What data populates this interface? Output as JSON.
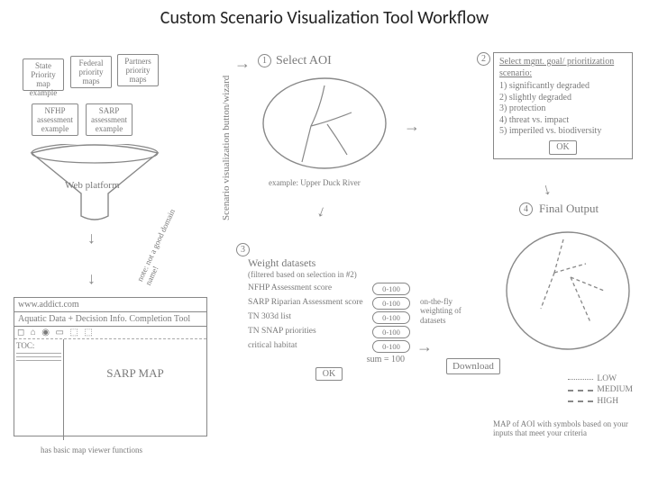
{
  "title": "Custom Scenario Visualization Tool Workflow",
  "inputs": {
    "a": "State Priority map example",
    "b": "Federal priority maps",
    "c": "Partners priority maps",
    "d": "NFHP assessment example",
    "e": "SARP assessment example"
  },
  "funnel_label": "Web platform",
  "side_note": "note: not a good domain name!",
  "vertical_label": "Scenario visualization button/wizard",
  "browser": {
    "url": "www.addict.com",
    "page_title": "Aquatic Data + Decision Info. Completion Tool",
    "toc_label": "TOC:",
    "toolbar_icons": "◻ ⌂ ◉ ▭ ⬚ ⬚",
    "map_label": "SARP MAP",
    "footer": "has basic map viewer functions"
  },
  "step1": {
    "num": "1",
    "title": "Select AOI",
    "example": "example: Upper Duck River"
  },
  "step2": {
    "num": "2",
    "title": "Select mgnt. goal/ prioritization scenario:",
    "opts": [
      "1) significantly degraded",
      "2) slightly degraded",
      "3) protection",
      "4) threat vs. impact",
      "5) imperiled vs. biodiversity"
    ],
    "ok": "OK"
  },
  "step3": {
    "num": "3",
    "title": "Weight datasets",
    "subtitle": "(filtered based on selection in #2)",
    "rows": [
      {
        "n": "NFHP Assessment score",
        "r": "0-100"
      },
      {
        "n": "SARP Riparian Assessment score",
        "r": "0-100"
      },
      {
        "n": "TN 303d list",
        "r": "0-100"
      },
      {
        "n": "TN SNAP priorities",
        "r": "0-100"
      },
      {
        "n": "critical habitat",
        "r": "0-100"
      }
    ],
    "sum": "sum = 100",
    "ok": "OK",
    "side": "on-the-fly weighting of datasets"
  },
  "step4": {
    "num": "4",
    "title": "Final Output",
    "download": "Download",
    "legend": {
      "low": "LOW",
      "med": "MEDIUM",
      "high": "HIGH"
    },
    "caption": "MAP of AOI with symbols based on your inputs that meet your criteria"
  },
  "arrows": {
    "r": "→",
    "d": "↓"
  }
}
